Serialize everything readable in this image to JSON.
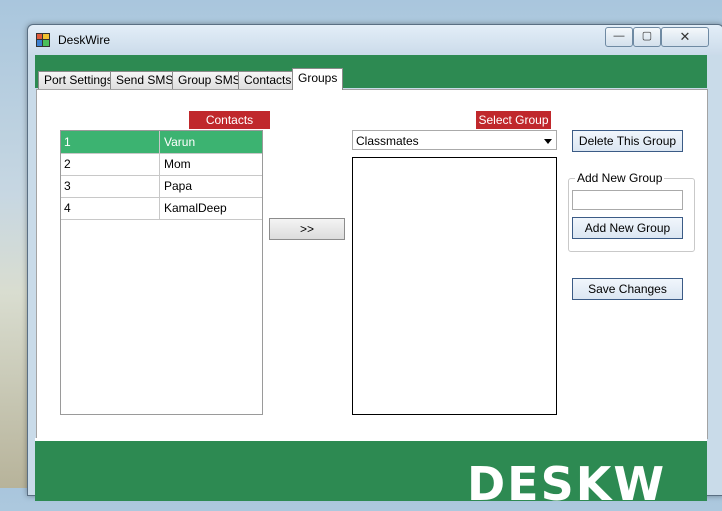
{
  "window": {
    "title": "DeskWire"
  },
  "titlebar_controls": {
    "minimize": "—",
    "maximize": "▢",
    "close": "✕"
  },
  "tabs": [
    {
      "label": "Port Settings"
    },
    {
      "label": "Send SMS"
    },
    {
      "label": "Group SMS"
    },
    {
      "label": "Contacts"
    },
    {
      "label": "Groups",
      "active": true
    }
  ],
  "contacts_panel": {
    "header": "Contacts",
    "rows": [
      {
        "num": "1",
        "name": "Varun",
        "selected": true
      },
      {
        "num": "2",
        "name": "Mom"
      },
      {
        "num": "3",
        "name": "Papa"
      },
      {
        "num": "4",
        "name": "KamalDeep"
      }
    ]
  },
  "move_button": {
    "label": ">>"
  },
  "group_panel": {
    "header": "Select Group",
    "selected_group": "Classmates"
  },
  "actions": {
    "delete_group": "Delete This Group",
    "add_group_legend": "Add New Group",
    "add_group_input": "",
    "add_group_button": "Add New Group",
    "save_changes": "Save Changes"
  },
  "footer": {
    "logo_text": "DESKW"
  },
  "colors": {
    "brand_green": "#2d8a52",
    "label_red": "#c0282c",
    "row_selected": "#3cb371"
  }
}
